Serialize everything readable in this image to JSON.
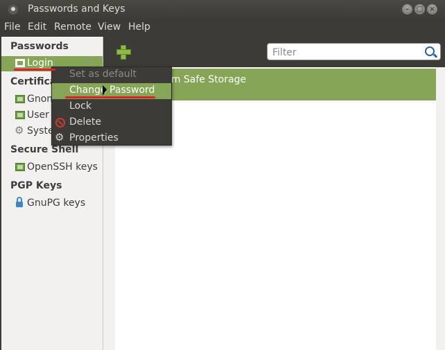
{
  "window": {
    "title": "Passwords and Keys"
  },
  "menubar": {
    "items": [
      "File",
      "Edit",
      "Remote",
      "View",
      "Help"
    ]
  },
  "sidebar": {
    "sections": [
      {
        "heading": "Passwords",
        "items": [
          {
            "label": "Login",
            "icon": "folder-icon",
            "selected": true
          }
        ]
      },
      {
        "heading": "Certifica",
        "items": [
          {
            "label": "Gnom",
            "icon": "folder-icon"
          },
          {
            "label": "User",
            "icon": "folder-icon"
          },
          {
            "label": "Syste",
            "icon": "gear-icon"
          }
        ]
      },
      {
        "heading": "Secure Shell",
        "items": [
          {
            "label": "OpenSSH keys",
            "icon": "folder-icon"
          }
        ]
      },
      {
        "heading": "PGP Keys",
        "items": [
          {
            "label": "GnuPG keys",
            "icon": "lock-icon"
          }
        ]
      }
    ]
  },
  "toolbar": {
    "add_icon": "add-icon",
    "search_placeholder": "Filter",
    "search_value": ""
  },
  "content": {
    "rows": [
      {
        "label": "ium Safe Storage",
        "selected": true
      }
    ]
  },
  "context_menu": {
    "items": [
      {
        "label": "Set as default",
        "disabled": true
      },
      {
        "label": "Change Password",
        "highlighted": true
      },
      {
        "label": "Lock"
      },
      {
        "label": "Delete",
        "icon": "delete-icon"
      },
      {
        "label": "Properties",
        "icon": "gear-icon"
      }
    ]
  },
  "colors": {
    "accent": "#87a556",
    "annotation": "#e0202a",
    "chrome": "#3c3b37"
  }
}
